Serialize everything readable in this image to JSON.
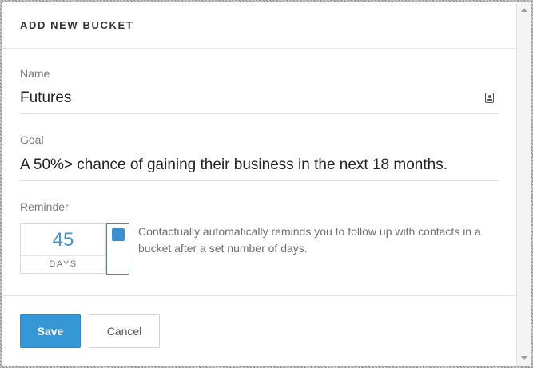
{
  "modal": {
    "title": "ADD NEW BUCKET"
  },
  "name_field": {
    "label": "Name",
    "value": "Futures",
    "icon": "contact-card-icon"
  },
  "goal_field": {
    "label": "Goal",
    "value": "A 50%> chance of gaining their business in the next 18 months."
  },
  "reminder": {
    "label": "Reminder",
    "days_value": "45",
    "days_unit": "DAYS",
    "enabled": true,
    "description": "Contactually automatically reminds you to follow up with contacts in a bucket after a set number of days."
  },
  "footer": {
    "save_label": "Save",
    "cancel_label": "Cancel"
  },
  "colors": {
    "accent": "#3597d5",
    "days_number": "#4b8fc9"
  }
}
